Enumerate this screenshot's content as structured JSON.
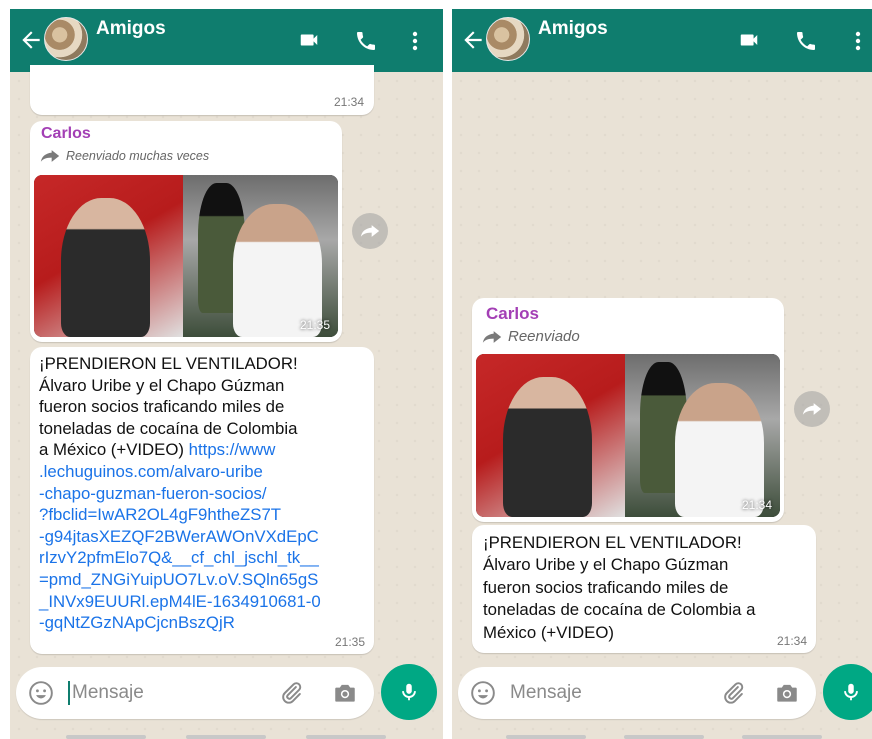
{
  "header": {
    "title": "Amigos"
  },
  "left_panel": {
    "top_bubble_time": "21:34",
    "sender": "Carlos",
    "forwarded_label": "Reenviado muchas veces",
    "image_time": "21:35",
    "text_lines": [
      "¡PRENDIERON EL VENTILADOR!",
      "Álvaro Uribe y el Chapo Gúzman",
      "fueron socios traficando miles de",
      "toneladas de cocaína de Colombia",
      "a México (+VIDEO) "
    ],
    "link_first": "https://www",
    "link_lines": [
      ".lechuguinos.com/alvaro-uribe",
      "-chapo-guzman-fueron-socios/",
      "?fbclid=IwAR2OL4gF9htheZS7T",
      "-g94jtasXEZQF2BWerAWOnVXdEpC",
      "rIzvY2pfmElo7Q&__cf_chl_jschl_tk__",
      "=pmd_ZNGiYuipUO7Lv.oV.SQln65gS",
      "_INVx9EUURl.epM4lE-1634910681-0",
      "-gqNtZGzNApCjcnBszQjR"
    ],
    "text_time": "21:35",
    "input_placeholder": "Mensaje"
  },
  "right_panel": {
    "sender": "Carlos",
    "forwarded_label": "Reenviado",
    "image_time": "21:34",
    "text_lines": [
      "¡PRENDIERON EL VENTILADOR!",
      "Álvaro Uribe y el Chapo Gúzman",
      "fueron socios traficando miles de",
      "toneladas de cocaína de Colombia a",
      "México (+VIDEO)"
    ],
    "text_time": "21:34",
    "input_placeholder": "Mensaje"
  },
  "colors": {
    "header": "#0f7d6e",
    "sender_name": "#a33fb5",
    "link": "#1a73e8",
    "mic_button": "#00a884"
  }
}
